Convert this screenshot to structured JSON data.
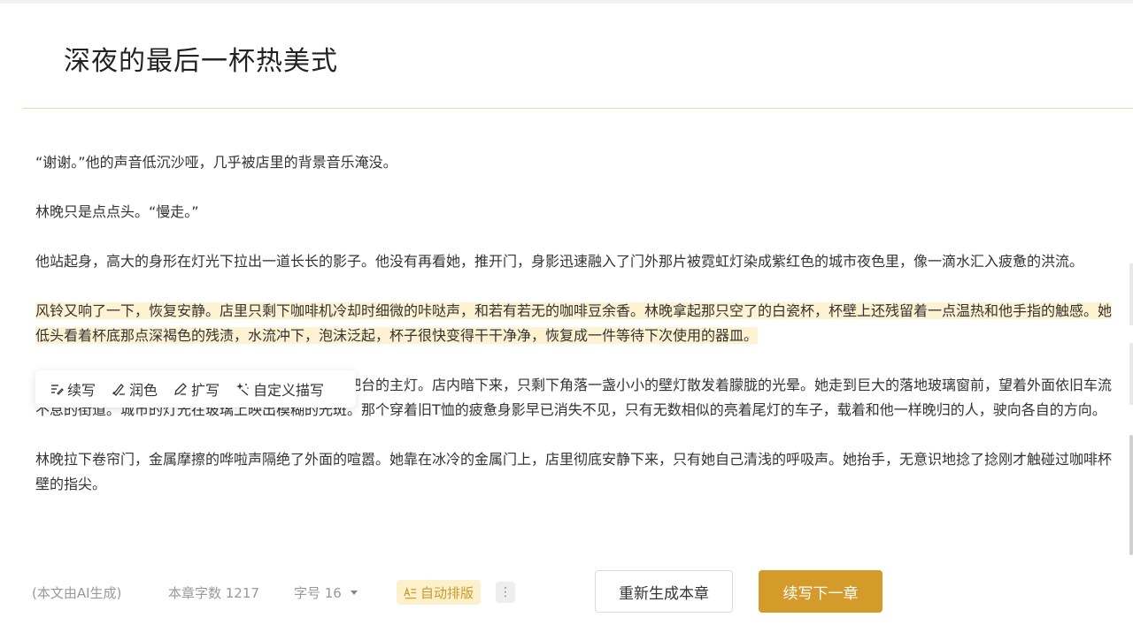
{
  "chapter": {
    "title": "深夜的最后一杯热美式"
  },
  "content": {
    "paragraphs": [
      "“谢谢。”他的声音低沉沙哑，几乎被店里的背景音乐淹没。",
      "林晚只是点点头。“慢走。”",
      "他站起身，高大的身形在灯光下拉出一道长长的影子。他没有再看她，推开门，身影迅速融入了门外那片被霓虹灯染成紫红色的城市夜色里，像一滴水汇入疲惫的洪流。",
      "风铃又响了一下，恢复安静。店里只剩下咖啡机冷却时细微的咔哒声，和若有若无的咖啡豆余香。林晚拿起那只空了的白瓷杯，杯壁上还残留着一点温热和他手指的触感。她低头看着杯底那点深褐色的残渍，水流冲下，泡沫泛起，杯子很快变得干干净净，恢复成一件等待下次使用的器皿。",
      "她把洗好的杯子倒扣在沥水架上，擦干手，关掉了吧台的主灯。店内暗下来，只剩下角落一盏小小的壁灯散发着朦胧的光晕。她走到巨大的落地玻璃窗前，望着外面依旧车流不息的街道。城市的灯光在玻璃上映出模糊的光斑。那个穿着旧T恤的疲惫身影早已消失不见，只有无数相似的亮着尾灯的车子，载着和他一样晚归的人，驶向各自的方向。",
      "林晚拉下卷帘门，金属摩擦的哗啦声隔绝了外面的喧嚣。她靠在冰冷的金属门上，店里彻底安静下来，只有她自己清浅的呼吸声。她抬手，无意识地捻了捻刚才触碰过咖啡杯壁的指尖。"
    ],
    "selected_index": 3
  },
  "toolbar": {
    "continue_label": "续写",
    "polish_label": "润色",
    "expand_label": "扩写",
    "custom_label": "自定义描写"
  },
  "footer": {
    "ai_note": "(本文由AI生成)",
    "word_count": "本章字数 1217",
    "font_size": "字号 16",
    "auto_layout": "自动排版",
    "more": "⋮",
    "regenerate_label": "重新生成本章",
    "next_chapter_label": "续写下一章"
  },
  "colors": {
    "accent": "#d49a2a",
    "highlight": "#fdf2d2",
    "auto_layout_bg": "#fdf1cc",
    "auto_layout_text": "#c9982c",
    "divider": "#ead9a8"
  },
  "icons": {
    "continue": "list-pen-icon",
    "polish": "brush-icon",
    "expand": "pen-icon",
    "custom": "sparkle-icon",
    "auto_layout": "text-layout-icon",
    "font_size_dropdown": "caret-down-icon",
    "more": "more-vertical-icon"
  }
}
